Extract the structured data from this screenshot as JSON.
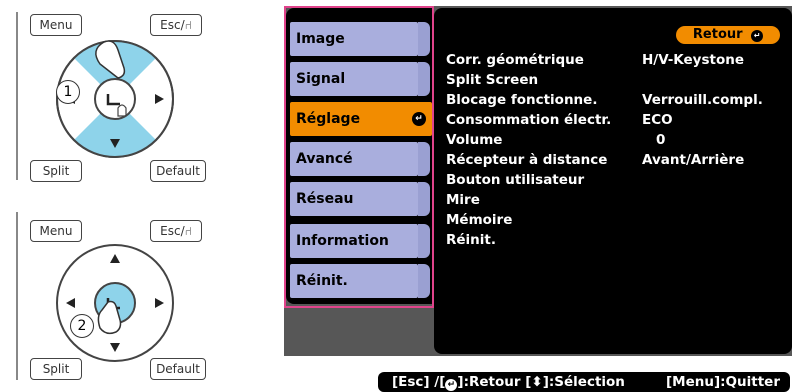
{
  "remote_top": {
    "menu": "Menu",
    "esc": "Esc/⑁",
    "split": "Split",
    "default": "Default",
    "step": "1"
  },
  "remote_bottom": {
    "menu": "Menu",
    "esc": "Esc/⑁",
    "split": "Split",
    "default": "Default",
    "step": "2"
  },
  "menu": {
    "categories": [
      {
        "label": "Image"
      },
      {
        "label": "Signal"
      },
      {
        "label": "Réglage",
        "selected": true
      },
      {
        "label": "Avancé"
      },
      {
        "label": "Réseau"
      },
      {
        "label": "Information"
      },
      {
        "label": "Réinit."
      }
    ],
    "back_label": "Retour",
    "items": [
      {
        "label": "Corr. géométrique",
        "value": "H/V-Keystone"
      },
      {
        "label": "Split Screen",
        "value": ""
      },
      {
        "label": "Blocage fonctionne.",
        "value": "Verrouill.compl."
      },
      {
        "label": "Consommation électr.",
        "value": "ECO"
      },
      {
        "label": "Volume",
        "value": "0"
      },
      {
        "label": "Récepteur à distance",
        "value": "Avant/Arrière"
      },
      {
        "label": "Bouton utilisateur",
        "value": ""
      },
      {
        "label": "Mire",
        "value": ""
      },
      {
        "label": "Mémoire",
        "value": ""
      },
      {
        "label": "Réinit.",
        "value": ""
      }
    ],
    "status_left_a": "[Esc] /[",
    "status_left_b": "]:Retour  [",
    "status_left_c": "]:Sélection",
    "status_right": "[Menu]:Quitter"
  },
  "colors": {
    "category_bg": "#a9aedd",
    "selected_bg": "#f28c00",
    "highlight_border": "#e0438b",
    "panel_bg": "#000000",
    "screen_bg": "#575757"
  },
  "icons": {
    "enter": "enter-icon",
    "updown": "up-down-arrow-icon",
    "finger": "pointing-finger-icon"
  }
}
